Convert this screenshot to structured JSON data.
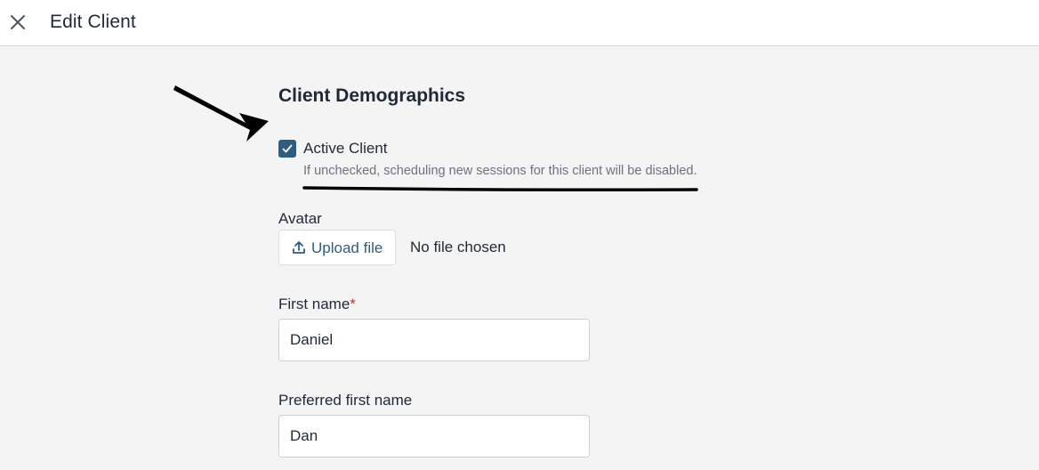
{
  "header": {
    "title": "Edit Client",
    "close_icon": "close-icon"
  },
  "section": {
    "title": "Client Demographics"
  },
  "active_client": {
    "label": "Active Client",
    "checked": true,
    "help_text": "If unchecked, scheduling new sessions for this client will be disabled."
  },
  "avatar": {
    "label": "Avatar",
    "upload_label": "Upload file",
    "upload_icon": "upload-icon",
    "file_status": "No file chosen"
  },
  "first_name": {
    "label": "First name",
    "required_mark": "*",
    "value": "Daniel"
  },
  "preferred_first_name": {
    "label": "Preferred first name",
    "value": "Dan"
  },
  "colors": {
    "accent": "#2f5d82",
    "required": "#c0392b",
    "background": "#f4f4f4"
  }
}
